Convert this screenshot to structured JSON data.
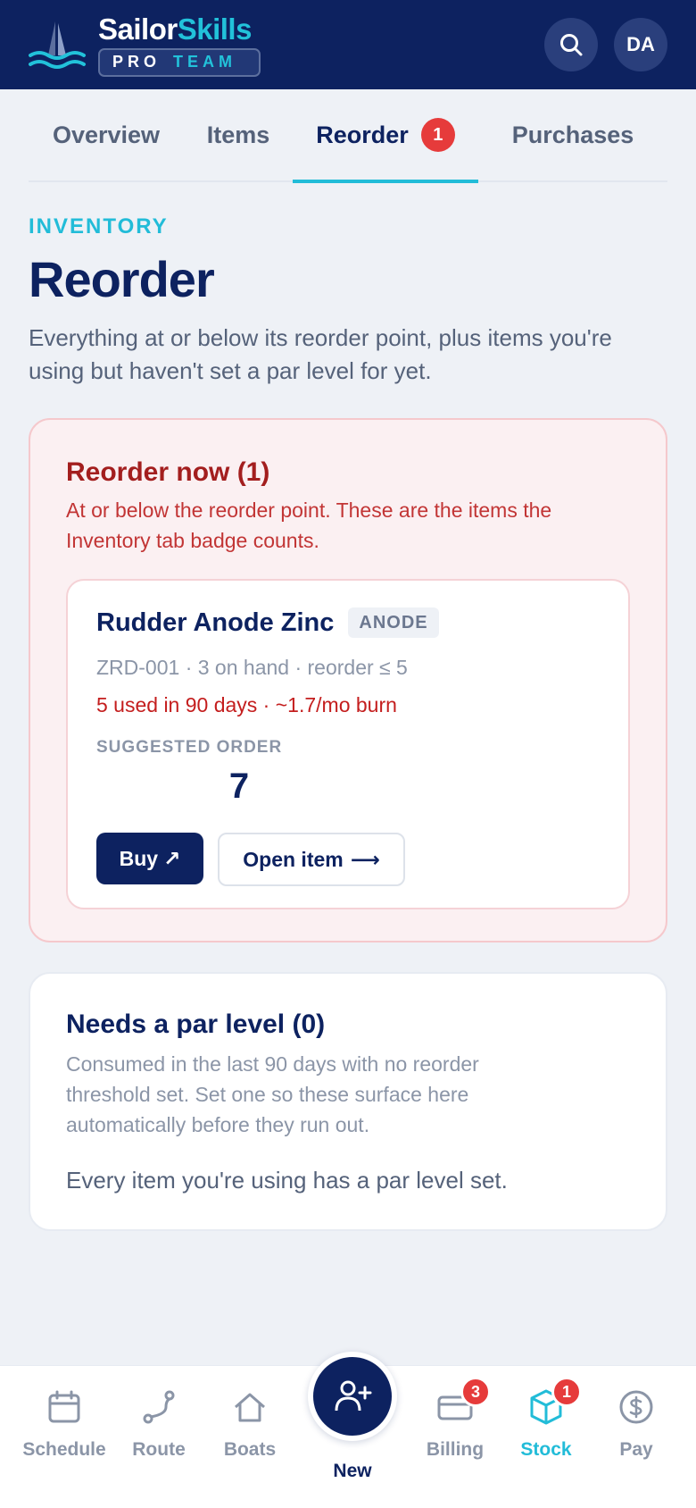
{
  "app": {
    "brand_part1": "Sailor",
    "brand_part2": "Skills",
    "badge_part1": "PRO",
    "badge_part2": "TEAM",
    "avatar_initials": "DA",
    "colors": {
      "navy": "#0d2260",
      "accent": "#22bcd8",
      "danger": "#e63b3b"
    }
  },
  "tabs": [
    {
      "label": "Overview"
    },
    {
      "label": "Items"
    },
    {
      "label": "Reorder",
      "badge": "1",
      "active": true
    },
    {
      "label": "Purchases"
    }
  ],
  "page": {
    "eyebrow": "INVENTORY",
    "title": "Reorder",
    "subtitle": "Everything at or below its reorder point, plus items you're using but haven't set a par level for yet."
  },
  "reorder_now": {
    "title": "Reorder now (1)",
    "description": "At or below the reorder point. These are the items the Inventory tab badge counts.",
    "item": {
      "name": "Rudder Anode Zinc",
      "tag": "ANODE",
      "meta": "ZRD-001 · 3 on hand · reorder ≤ 5",
      "burn": "5 used in 90 days · ~1.7/mo burn",
      "suggested_label": "SUGGESTED ORDER",
      "suggested_value": "7",
      "buy_label": "Buy",
      "buy_icon": "↗",
      "open_label": "Open item",
      "open_icon": "⟶"
    }
  },
  "needs_par": {
    "title": "Needs a par level (0)",
    "description": "Consumed in the last 90 days with no reorder threshold set. Set one so these surface here automatically before they run out.",
    "empty": "Every item you're using has a par level set."
  },
  "bottom_nav": {
    "schedule": "Schedule",
    "route": "Route",
    "boats": "Boats",
    "new": "New",
    "billing": "Billing",
    "billing_badge": "3",
    "stock": "Stock",
    "stock_badge": "1",
    "pay": "Pay"
  }
}
